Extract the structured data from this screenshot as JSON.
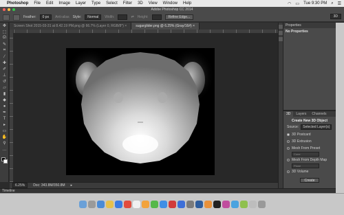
{
  "menubar": {
    "app": "Photoshop",
    "items": [
      "File",
      "Edit",
      "Image",
      "Layer",
      "Type",
      "Select",
      "Filter",
      "3D",
      "View",
      "Window",
      "Help"
    ],
    "clock": "Tue 9:30 PM"
  },
  "window": {
    "title": "Adobe Photoshop CC 2014"
  },
  "options": {
    "feather_label": "Feather:",
    "feather_value": "0 px",
    "antialias": "Anti-alias",
    "style_label": "Style:",
    "style_value": "Normal",
    "width_label": "Width:",
    "height_label": "Height:",
    "refine": "Refine Edge...",
    "workspace": "3D"
  },
  "tabs": [
    {
      "label": "Screen Shot 2015-03-31 at 8.42.19 PM.png @ 66.7% (Layer 0, RGB/8*) ×"
    },
    {
      "label": "sugarglider.png @ 6.25% (Gray/16#) ×"
    }
  ],
  "status": {
    "zoom": "6.25%",
    "doc": "Doc: 343.8M/350.8M"
  },
  "timeline": {
    "label": "Timeline"
  },
  "properties": {
    "header": "Properties",
    "empty": "No Properties"
  },
  "threed": {
    "tabs": [
      "3D",
      "Layers",
      "Channels"
    ],
    "title": "Create New 3D Object",
    "source_label": "Source:",
    "source_value": "Selected Layer(s)",
    "options": [
      "3D Postcard",
      "3D Extrusion",
      "Mesh From Preset",
      "Mesh From Depth Map",
      "3D Volume"
    ],
    "preset_dd": "Cone",
    "depth_dd": "Plane",
    "create": "Create"
  },
  "colors": {
    "accent": "#3a6ea5",
    "panel": "#4a4a4a",
    "canvas": "#282828"
  }
}
